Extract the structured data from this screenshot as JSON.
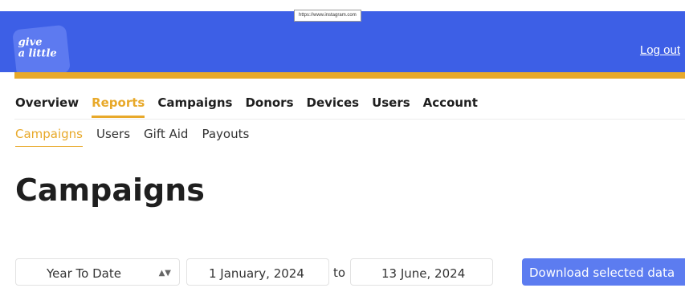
{
  "tooltip": {
    "url": "https://www.instagram.com"
  },
  "header": {
    "logo_line1": "give",
    "logo_line2": "a little",
    "logout_label": "Log out"
  },
  "colors": {
    "brand_blue": "#3d5fe6",
    "accent_gold": "#e8a92a",
    "button_blue": "#5c7cf0"
  },
  "main_nav": [
    {
      "label": "Overview",
      "active": false
    },
    {
      "label": "Reports",
      "active": true
    },
    {
      "label": "Campaigns",
      "active": false
    },
    {
      "label": "Donors",
      "active": false
    },
    {
      "label": "Devices",
      "active": false
    },
    {
      "label": "Users",
      "active": false
    },
    {
      "label": "Account",
      "active": false
    }
  ],
  "sub_nav": [
    {
      "label": "Campaigns",
      "active": true
    },
    {
      "label": "Users",
      "active": false
    },
    {
      "label": "Gift Aid",
      "active": false
    },
    {
      "label": "Payouts",
      "active": false
    }
  ],
  "page": {
    "title": "Campaigns"
  },
  "filters": {
    "period_select": "Year To Date",
    "start_date": "1 January, 2024",
    "to_label": "to",
    "end_date": "13 June, 2024",
    "download_label": "Download selected data"
  }
}
